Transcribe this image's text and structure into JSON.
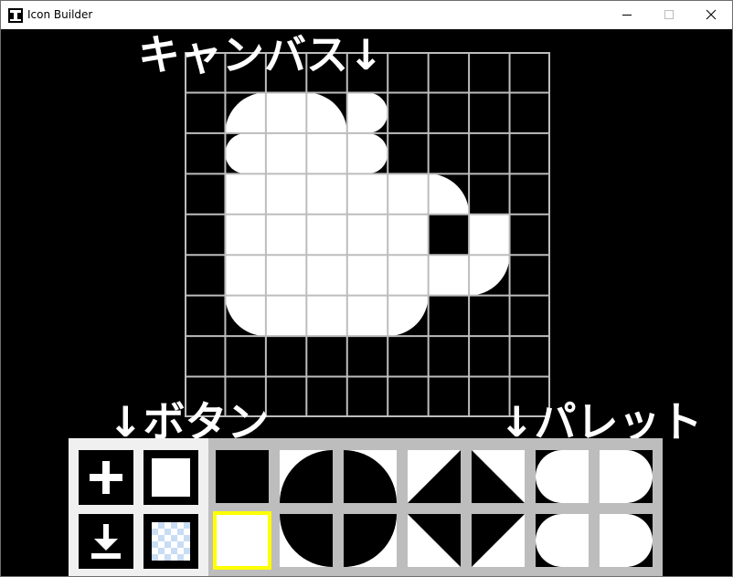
{
  "window": {
    "title": "Icon Builder"
  },
  "annotations": {
    "canvas": "キャンバス↓",
    "buttons": "↓ボタン",
    "palette": "↓パレット"
  },
  "canvas": {
    "columns": 9,
    "rows": 9,
    "grid_color": "#bdbdbd",
    "background": "#000000",
    "cells": [
      [
        "empty",
        "empty",
        "empty",
        "empty",
        "empty",
        "empty",
        "empty",
        "empty",
        "empty"
      ],
      [
        "empty",
        "round-tl",
        "full",
        "round-tr",
        "round-r-wide",
        "empty",
        "empty",
        "empty",
        "empty"
      ],
      [
        "empty",
        "round-l-wide",
        "full",
        "full",
        "round-tr-br",
        "empty",
        "empty",
        "empty",
        "empty"
      ],
      [
        "empty",
        "full",
        "full",
        "full",
        "full",
        "full",
        "round-tr",
        "empty",
        "empty"
      ],
      [
        "empty",
        "full",
        "full",
        "full",
        "full",
        "full",
        "empty",
        "full",
        "empty"
      ],
      [
        "empty",
        "full",
        "full",
        "full",
        "full",
        "full",
        "full",
        "round-br",
        "empty"
      ],
      [
        "empty",
        "round-bl",
        "full",
        "full",
        "full",
        "round-br",
        "empty",
        "empty",
        "empty"
      ],
      [
        "empty",
        "empty",
        "empty",
        "empty",
        "empty",
        "empty",
        "empty",
        "empty",
        "empty"
      ],
      [
        "empty",
        "empty",
        "empty",
        "empty",
        "empty",
        "empty",
        "empty",
        "empty",
        "empty"
      ]
    ]
  },
  "tools": [
    {
      "name": "new-button",
      "icon": "plus-icon"
    },
    {
      "name": "fill-button",
      "icon": "white-square-icon"
    },
    {
      "name": "save-button",
      "icon": "download-icon"
    },
    {
      "name": "transparent-button",
      "icon": "checker-icon"
    }
  ],
  "palette": {
    "selected_index": 7,
    "highlight_color": "#ffff00",
    "swatches": [
      "solid-black",
      "quarter-tl",
      "quarter-tr",
      "triangle-bl",
      "triangle-tr",
      "half-circle-left",
      "half-circle-right",
      "solid-white",
      "quarter-bl",
      "quarter-br",
      "triangle-tl",
      "triangle-br",
      "half-circle-left-inv",
      "half-circle-right-inv"
    ]
  },
  "colors": {
    "foreground": "#ffffff",
    "background": "#000000",
    "panel": "#bdbdbd",
    "button_panel": "#f0f0f0",
    "checker": "#c8dcf4"
  }
}
